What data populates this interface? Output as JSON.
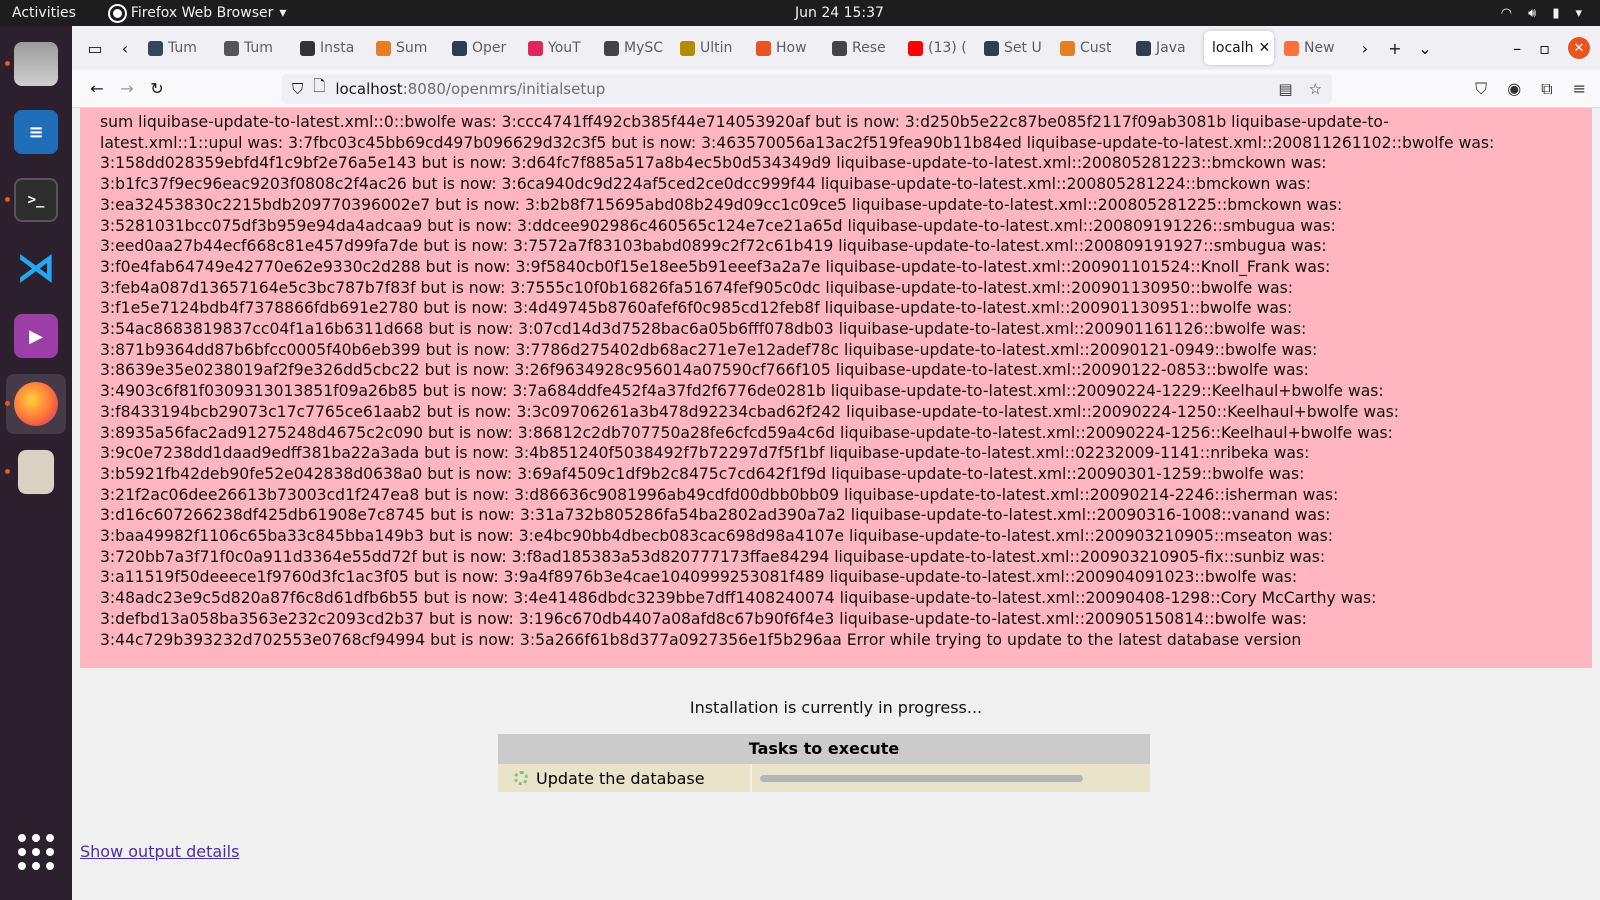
{
  "topbar": {
    "activities": "Activities",
    "app_name": "Firefox Web Browser",
    "clock": "Jun 24  15:37"
  },
  "dock": {
    "items": [
      {
        "name": "files",
        "label": ""
      },
      {
        "name": "writer",
        "label": ""
      },
      {
        "name": "terminal",
        "label": ">_"
      },
      {
        "name": "vscode",
        "label": "⋊"
      },
      {
        "name": "media",
        "label": "▶"
      },
      {
        "name": "firefox",
        "label": ""
      },
      {
        "name": "archive",
        "label": ""
      }
    ]
  },
  "tabs": [
    {
      "label": "Tum",
      "color": "#36465d"
    },
    {
      "label": "Tum",
      "color": "#555"
    },
    {
      "label": "Insta",
      "color": "#333"
    },
    {
      "label": "Sum",
      "color": "#e67e22"
    },
    {
      "label": "Oper",
      "color": "#2c3e50"
    },
    {
      "label": "YouT",
      "color": "#e0245e"
    },
    {
      "label": "MySC",
      "color": "#444"
    },
    {
      "label": "Ultin",
      "color": "#b38b00"
    },
    {
      "label": "How",
      "color": "#e95420"
    },
    {
      "label": "Rese",
      "color": "#444"
    },
    {
      "label": "(13) (",
      "color": "#ff0000"
    },
    {
      "label": "Set U",
      "color": "#2c3e50"
    },
    {
      "label": "Cust",
      "color": "#e67e22"
    },
    {
      "label": "Java",
      "color": "#2c3e50"
    },
    {
      "label": "localh",
      "color": "#fff",
      "selected": true
    },
    {
      "label": "New",
      "color": "#ff7139"
    }
  ],
  "url": {
    "host": "localhost",
    "path": ":8080/openmrs/initialsetup"
  },
  "error": {
    "lines": [
      "sum liquibase-update-to-latest.xml::0::bwolfe was: 3:ccc4741ff492cb385f44e714053920af but is now: 3:d250b5e22c87be085f2117f09ab3081b liquibase-update-to-",
      "latest.xml::1::upul was: 3:7fbc03c45bb69cd497b096629d32c3f5 but is now: 3:463570056a13ac2f519fea90b11b84ed liquibase-update-to-latest.xml::200811261102::bwolfe was:",
      "3:158dd028359ebfd4f1c9bf2e76a5e143 but is now: 3:d64fc7f885a517a8b4ec5b0d534349d9 liquibase-update-to-latest.xml::200805281223::bmckown was:",
      "3:b1fc37f9ec96eac9203f0808c2f4ac26 but is now: 3:6ca940dc9d224af5ced2ce0dcc999f44 liquibase-update-to-latest.xml::200805281224::bmckown was:",
      "3:ea32453830c2215bdb209770396002e7 but is now: 3:b2b8f715695abd08b249d09cc1c09ce5 liquibase-update-to-latest.xml::200805281225::bmckown was:",
      "3:5281031bcc075df3b959e94da4adcaa9 but is now: 3:ddcee902986c460565c124e7ce21a65d liquibase-update-to-latest.xml::200809191226::smbugua was:",
      "3:eed0aa27b44ecf668c81e457d99fa7de but is now: 3:7572a7f83103babd0899c2f72c61b419 liquibase-update-to-latest.xml::200809191927::smbugua was:",
      "3:f0e4fab64749e42770e62e9330c2d288 but is now: 3:9f5840cb0f15e18ee5b91eeef3a2a7e liquibase-update-to-latest.xml::200901101524::Knoll_Frank was:",
      "3:feb4a087d13657164e5c3bc787b7f83f but is now: 3:7555c10f0b16826fa51674fef905c0dc liquibase-update-to-latest.xml::200901130950::bwolfe was:",
      "3:f1e5e7124bdb4f7378866fdb691e2780 but is now: 3:4d49745b8760afef6f0c985cd12feb8f liquibase-update-to-latest.xml::200901130951::bwolfe was:",
      "3:54ac8683819837cc04f1a16b6311d668 but is now: 3:07cd14d3d7528bac6a05b6fff078db03 liquibase-update-to-latest.xml::200901161126::bwolfe was:",
      "3:871b9364dd87b6bfcc0005f40b6eb399 but is now: 3:7786d275402db68ac271e7e12adef78c liquibase-update-to-latest.xml::20090121-0949::bwolfe was:",
      "3:8639e35e0238019af2f9e326dd5cbc22 but is now: 3:26f9634928c956014a07590cf766f105 liquibase-update-to-latest.xml::20090122-0853::bwolfe was:",
      "3:4903c6f81f0309313013851f09a26b85 but is now: 3:7a684ddfe452f4a37fd2f6776de0281b liquibase-update-to-latest.xml::20090224-1229::Keelhaul+bwolfe was:",
      "3:f8433194bcb29073c17c7765ce61aab2 but is now: 3:3c09706261a3b478d92234cbad62f242 liquibase-update-to-latest.xml::20090224-1250::Keelhaul+bwolfe was:",
      "3:8935a56fac2ad91275248d4675c2c090 but is now: 3:86812c2db707750a28fe6cfcd59a4c6d liquibase-update-to-latest.xml::20090224-1256::Keelhaul+bwolfe was:",
      "3:9c0e7238dd1daad9edff381ba22a3ada but is now: 3:4b851240f5038492f7b72297d7f5f1bf liquibase-update-to-latest.xml::02232009-1141::nribeka was:",
      "3:b5921fb42deb90fe52e042838d0638a0 but is now: 3:69af4509c1df9b2c8475c7cd642f1f9d liquibase-update-to-latest.xml::20090301-1259::bwolfe was:",
      "3:21f2ac06dee26613b73003cd1f247ea8 but is now: 3:d86636c9081996ab49cdfd00dbb0bb09 liquibase-update-to-latest.xml::20090214-2246::isherman was:",
      "3:d16c607266238df425db61908e7c8745 but is now: 3:31a732b805286fa54ba2802ad390a7a2 liquibase-update-to-latest.xml::20090316-1008::vanand was:",
      "3:baa49982f1106c65ba33c845bba149b3 but is now: 3:e4bc90bb4dbecb083cac698d98a4107e liquibase-update-to-latest.xml::200903210905::mseaton was:",
      "3:720bb7a3f71f0c0a911d3364e55dd72f but is now: 3:f8ad185383a53d820777173ffae84294 liquibase-update-to-latest.xml::200903210905-fix::sunbiz was:",
      "3:a11519f50deeece1f9760d3fc1ac3f05 but is now: 3:9a4f8976b3e4cae1040999253081f489 liquibase-update-to-latest.xml::200904091023::bwolfe was:",
      "3:48adc23e9c5d820a87f6c8d61dfb6b55 but is now: 3:4e41486dbdc3239bbe7dff1408240074 liquibase-update-to-latest.xml::20090408-1298::Cory McCarthy was:",
      "3:defbd13a058ba3563e232c2093cd2b37 but is now: 3:196c670db4407a08afd8c67b90f6f4e3 liquibase-update-to-latest.xml::200905150814::bwolfe was:",
      "3:44c729b393232d702553e0768cf94994 but is now: 3:5a266f61b8d377a0927356e1f5b296aa Error while trying to update to the latest database version"
    ]
  },
  "install": {
    "message": "Installation is currently in progress...",
    "tasks_header": "Tasks to execute",
    "task_name": "Update the database",
    "task_progress": 0.95
  },
  "show_output": "Show output details"
}
